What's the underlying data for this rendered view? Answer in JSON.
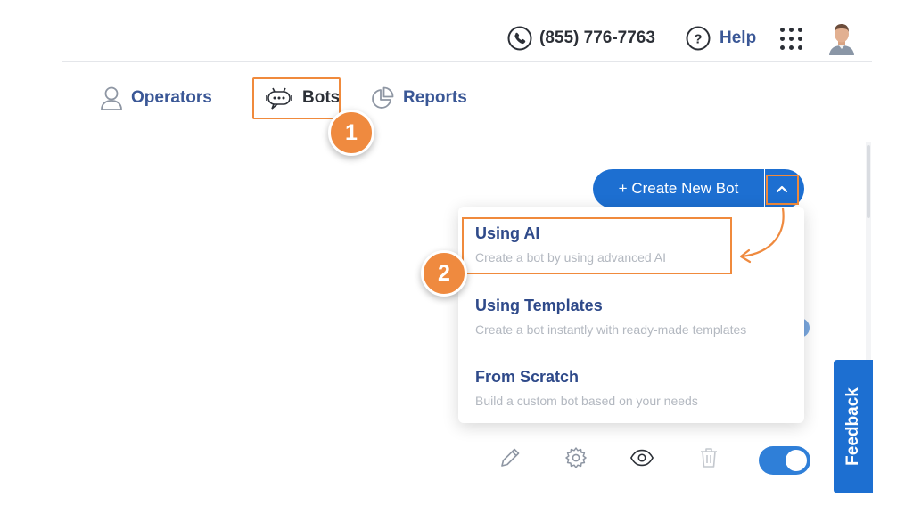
{
  "header": {
    "phone_number": "(855) 776-7763",
    "help_label": "Help"
  },
  "nav": {
    "tabs": [
      {
        "label": "Operators",
        "icon": "user-icon"
      },
      {
        "label": "Bots",
        "icon": "bot-icon"
      },
      {
        "label": "Reports",
        "icon": "pie-chart-icon"
      }
    ]
  },
  "callouts": {
    "step1": "1",
    "step2": "2"
  },
  "create_bot": {
    "label": "+ Create New Bot"
  },
  "dropdown": {
    "items": [
      {
        "title": "Using AI",
        "description": "Create a bot by using advanced AI"
      },
      {
        "title": "Using Templates",
        "description": "Create a bot instantly with ready-made templates"
      },
      {
        "title": "From Scratch",
        "description": "Build a custom bot based on your needs"
      }
    ]
  },
  "actions": [
    "edit-icon",
    "settings-icon",
    "eye-icon",
    "trash-icon"
  ],
  "bot_enabled": true,
  "feedback": {
    "label": "Feedback"
  },
  "colors": {
    "primary": "#1d6fd1",
    "annotation": "#ef8a3f",
    "nav_text": "#3a5796"
  }
}
